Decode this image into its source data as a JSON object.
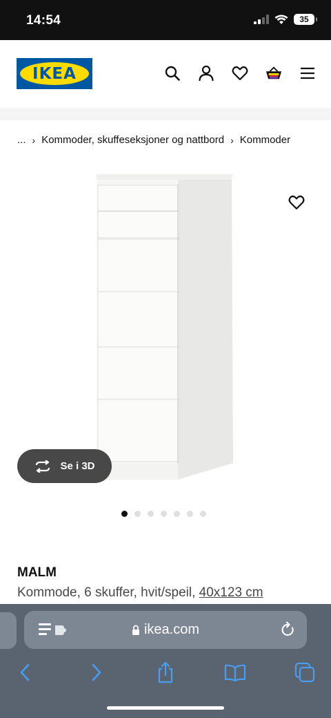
{
  "status_bar": {
    "time": "14:54",
    "battery": "35"
  },
  "header": {
    "logo_text": "IKEA"
  },
  "breadcrumb": {
    "ellipsis": "...",
    "items": [
      "Kommoder, skuffeseksjoner og nattbord",
      "Kommoder"
    ]
  },
  "gallery": {
    "view_3d_label": "Se i 3D",
    "image_count": 7,
    "active_image": 1
  },
  "product": {
    "name": "MALM",
    "description": "Kommode, 6 skuffer, hvit/speil, ",
    "size": "40x123 cm"
  },
  "browser": {
    "url": "ikea.com"
  },
  "colors": {
    "ikea_blue": "#0058a3",
    "ikea_yellow": "#ffdb00",
    "button_dark": "#484848",
    "browser_bar": "#5a6470"
  },
  "icons": [
    "search-icon",
    "profile-icon",
    "heart-icon",
    "basket-icon",
    "menu-icon",
    "rotate-3d-icon",
    "lock-icon",
    "reload-icon",
    "back-icon",
    "forward-icon",
    "share-icon",
    "bookmarks-icon",
    "tabs-icon"
  ]
}
